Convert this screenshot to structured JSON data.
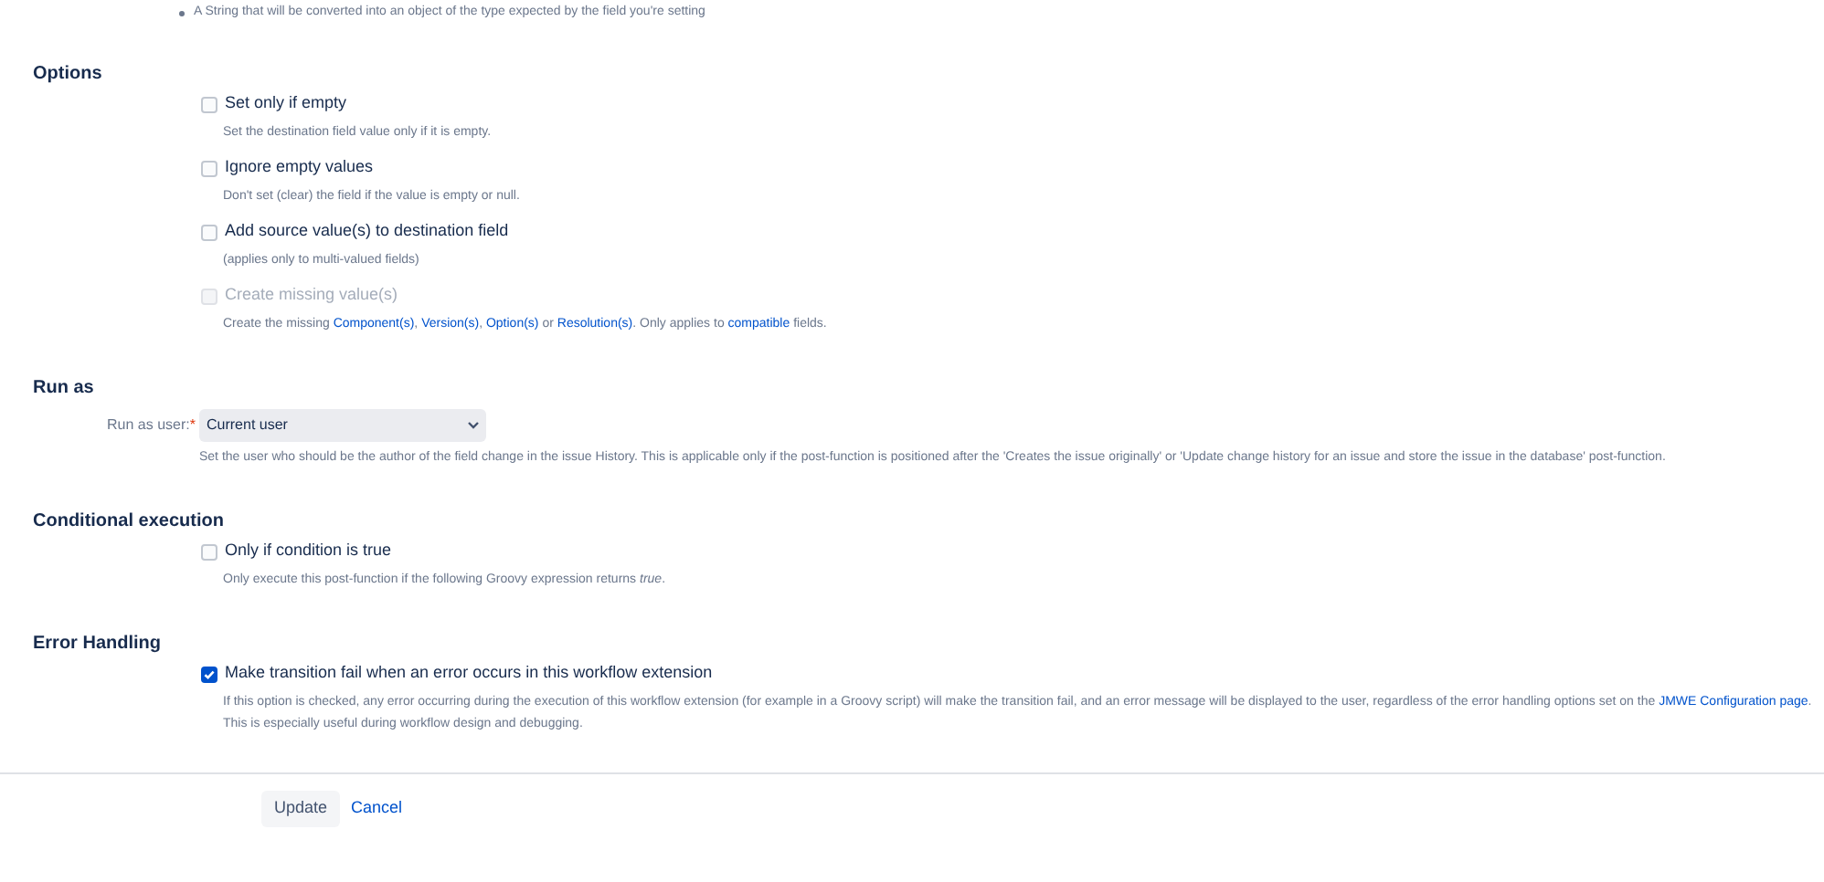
{
  "intro_bullet": "A String that will be converted into an object of the type expected by the field you're setting",
  "sections": [
    {
      "title": "Options",
      "items": [
        {
          "kind": "checkbox",
          "label": "Set only if empty",
          "checked": false,
          "disabled": false,
          "description": [
            {
              "text": "Set the destination field value only if it is empty.",
              "link": false
            }
          ]
        },
        {
          "kind": "checkbox",
          "label": "Ignore empty values",
          "checked": false,
          "disabled": false,
          "description": [
            {
              "text": "Don't set (clear) the field if the value is empty or null.",
              "link": false
            }
          ]
        },
        {
          "kind": "checkbox",
          "label": "Add source value(s) to destination field",
          "checked": false,
          "disabled": false,
          "description": [
            {
              "text": "(applies only to multi-valued fields)",
              "link": false
            }
          ]
        },
        {
          "kind": "checkbox",
          "label": "Create missing value(s)",
          "checked": false,
          "disabled": true,
          "description": [
            {
              "text": "Create the missing ",
              "link": false
            },
            {
              "text": "Component(s)",
              "link": true
            },
            {
              "text": ", ",
              "link": false
            },
            {
              "text": "Version(s)",
              "link": true
            },
            {
              "text": ", ",
              "link": false
            },
            {
              "text": "Option(s)",
              "link": true
            },
            {
              "text": " or ",
              "link": false
            },
            {
              "text": "Resolution(s)",
              "link": true
            },
            {
              "text": ". Only applies to ",
              "link": false
            },
            {
              "text": "compatible",
              "link": true
            },
            {
              "text": " fields.",
              "link": false
            }
          ]
        }
      ]
    },
    {
      "title": "Run as",
      "items": [
        {
          "kind": "select",
          "label": "Run as user:",
          "required": true,
          "required_mark": "*",
          "value": "Current user",
          "description": [
            {
              "text": "Set the user who should be the author of the field change in the issue History. This is applicable only if the post-function is positioned after the 'Creates the issue originally' or 'Update change history for an issue and store the issue in the database' post-function.",
              "link": false
            }
          ]
        }
      ]
    },
    {
      "title": "Conditional execution",
      "items": [
        {
          "kind": "checkbox",
          "label": "Only if condition is true",
          "checked": false,
          "disabled": false,
          "description": [
            {
              "text": "Only execute this post-function if the following Groovy expression returns *true*.",
              "link": false
            }
          ]
        }
      ]
    },
    {
      "title": "Error Handling",
      "items": [
        {
          "kind": "checkbox",
          "label": "Make transition fail when an error occurs in this workflow extension",
          "checked": true,
          "disabled": false,
          "description": [
            {
              "text": "If this option is checked, any error occurring during the execution of this workflow extension (for example in a Groovy script) will make the transition fail, and an error message will be displayed to the user, regardless of the error handling options set on the ",
              "link": false
            },
            {
              "text": "JMWE Configuration page",
              "link": true
            },
            {
              "text": ".",
              "link": false
            },
            {
              "text": "This is especially useful during workflow design and debugging.",
              "link": false,
              "new_line": true
            }
          ]
        }
      ]
    }
  ],
  "buttons": {
    "update": "Update",
    "cancel": "Cancel"
  }
}
